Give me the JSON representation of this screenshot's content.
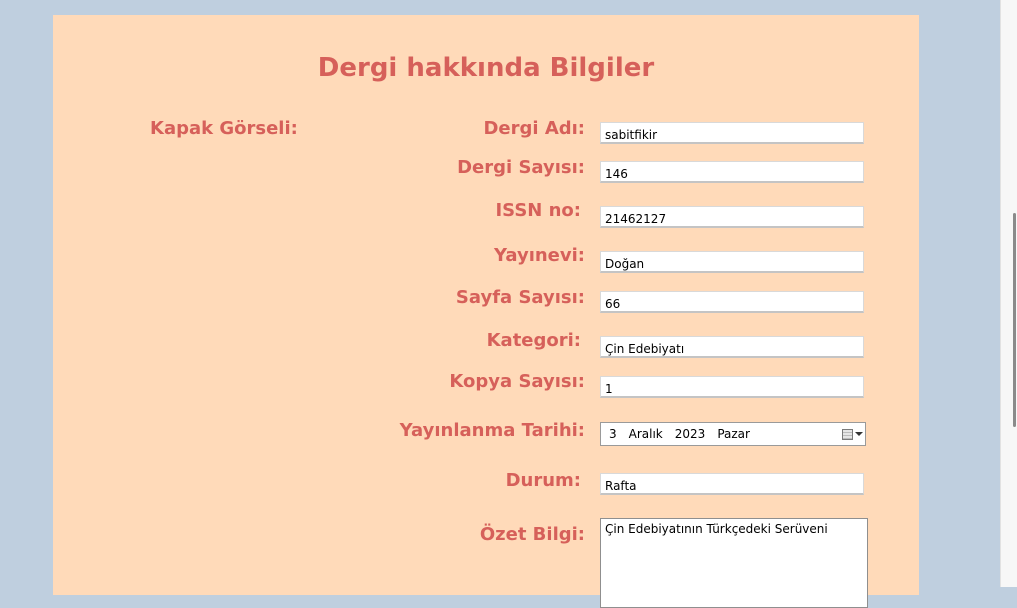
{
  "form": {
    "title": "Dergi hakkında Bilgiler",
    "cover_label": "Kapak Görseli:",
    "fields": {
      "name_label": "Dergi Adı:",
      "name_value": "sabitfikir",
      "issue_label": "Dergi Sayısı:",
      "issue_value": "146",
      "issn_label": "ISSN no:",
      "issn_value": "21462127",
      "publisher_label": "Yayınevi:",
      "publisher_value": "Doğan",
      "pages_label": "Sayfa Sayısı:",
      "pages_value": "66",
      "category_label": "Kategori:",
      "category_value": "Çin Edebiyatı",
      "copies_label": "Kopya Sayısı:",
      "copies_value": "1",
      "pubdate_label": "Yayınlanma Tarihi:",
      "pubdate_day": "3",
      "pubdate_month": "Aralık",
      "pubdate_year": "2023",
      "pubdate_weekday": "Pazar",
      "status_label": "Durum:",
      "status_value": "Rafta",
      "summary_label": "Özet Bilgi:",
      "summary_value": "Çin Edebiyatının Türkçedeki Serüveni"
    }
  },
  "icons": {
    "calendar": "calendar-icon",
    "dropdown": "chevron-down-icon"
  },
  "colors": {
    "background": "#bfcfdf",
    "panel": "#ffdab9",
    "accent": "#d6605a"
  }
}
